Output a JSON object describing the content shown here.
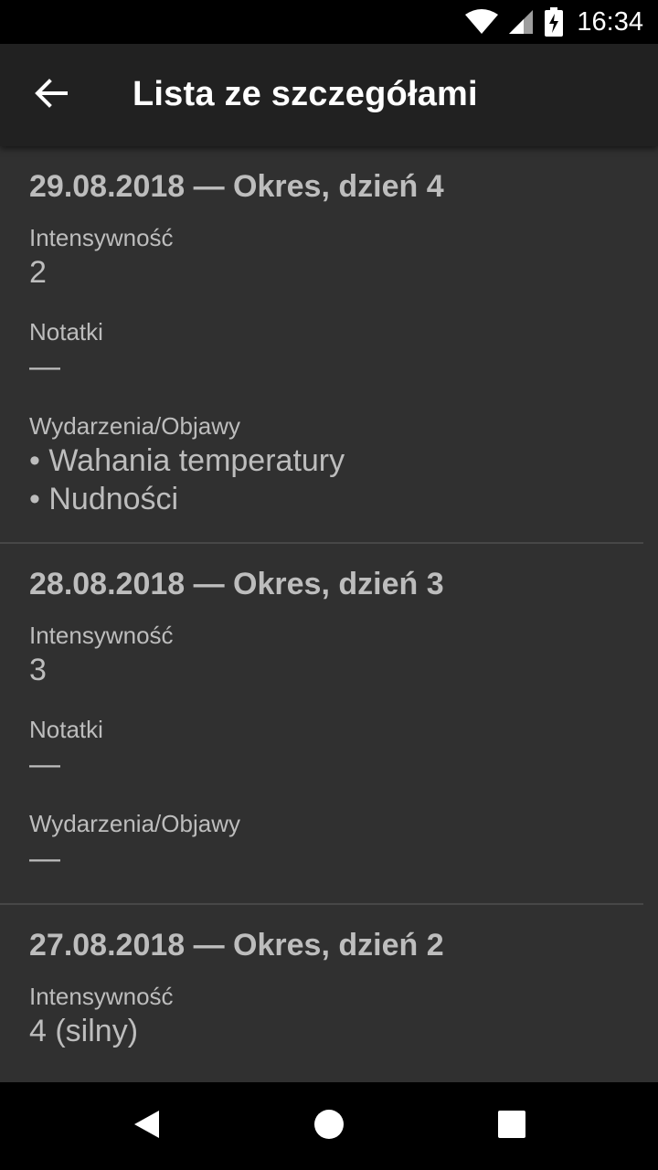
{
  "status_bar": {
    "time": "16:34",
    "icons": [
      "wifi-icon",
      "cell-signal-icon",
      "battery-charging-icon"
    ]
  },
  "app_bar": {
    "title": "Lista ze szczegółami",
    "back_icon": "arrow-back-icon"
  },
  "entries": [
    {
      "title": "29.08.2018 — Okres, dzień 4",
      "intensity_label": "Intensywność",
      "intensity_value": "2",
      "notes_label": "Notatki",
      "notes_value": "—",
      "events_label": "Wydarzenia/Objawy",
      "events": [
        "• Wahania temperatury",
        "• Nudności"
      ]
    },
    {
      "title": "28.08.2018 — Okres, dzień 3",
      "intensity_label": "Intensywność",
      "intensity_value": "3",
      "notes_label": "Notatki",
      "notes_value": "—",
      "events_label": "Wydarzenia/Objawy",
      "events": [
        "—"
      ]
    },
    {
      "title": "27.08.2018 — Okres, dzień 2",
      "intensity_label": "Intensywność",
      "intensity_value": "4 (silny)"
    }
  ],
  "nav_bar": {
    "buttons": [
      "back-triangle-icon",
      "home-circle-icon",
      "recents-square-icon"
    ]
  },
  "colors": {
    "background": "#303030",
    "app_bar": "#212121",
    "text": "#bdbdbd",
    "divider": "#474747"
  }
}
